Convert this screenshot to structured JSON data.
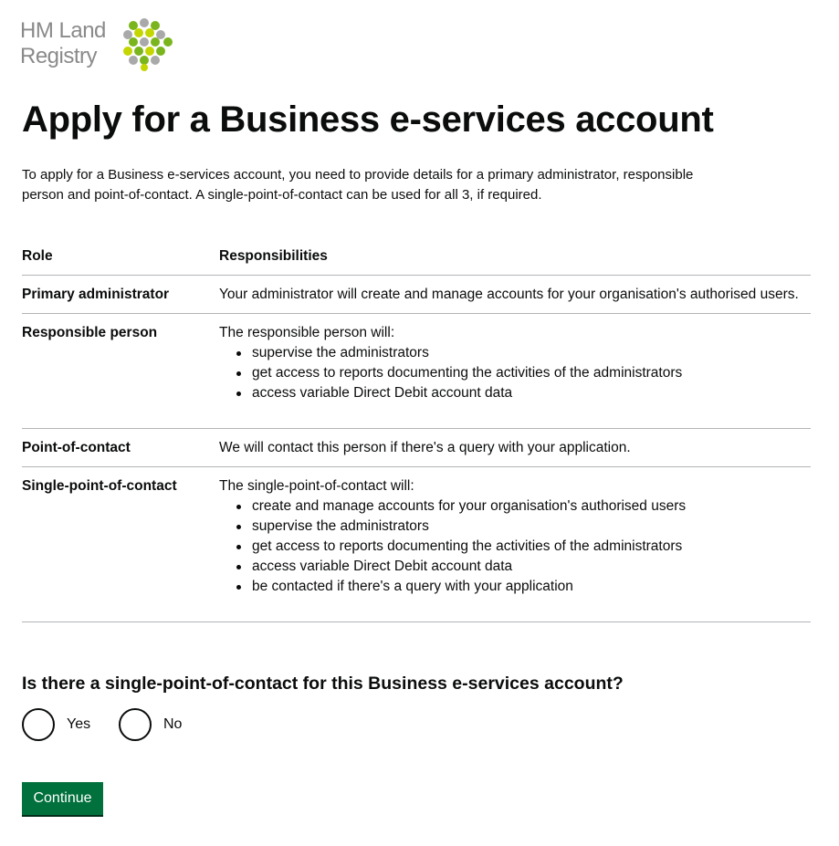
{
  "header": {
    "logo_line1": "HM Land",
    "logo_line2": "Registry"
  },
  "page_title": "Apply for a Business e-services account",
  "intro": "To apply for a Business e-services account, you need to provide details for a primary administrator, responsible person and point-of-contact. A single-point-of-contact can be used for all 3, if required.",
  "table": {
    "headers": [
      "Role",
      "Responsibilities"
    ],
    "rows": [
      {
        "role": "Primary administrator",
        "text": "Your administrator will create and manage accounts for your organisation's authorised users.",
        "bullets": []
      },
      {
        "role": "Responsible person",
        "text": "The responsible person will:",
        "bullets": [
          "supervise the administrators",
          "get access to reports documenting the activities of the administrators",
          "access variable Direct Debit account data"
        ]
      },
      {
        "role": "Point-of-contact",
        "text": "We will contact this person if there's a query with your application.",
        "bullets": []
      },
      {
        "role": "Single-point-of-contact",
        "text": "The single-point-of-contact will:",
        "bullets": [
          "create and manage accounts for your organisation's authorised users",
          "supervise the administrators",
          "get access to reports documenting the activities of the administrators",
          "access variable Direct Debit account data",
          "be contacted if there's a query with your application"
        ]
      }
    ]
  },
  "question": {
    "label": "Is there a single-point-of-contact for this Business e-services account?",
    "options": [
      "Yes",
      "No"
    ]
  },
  "continue_label": "Continue",
  "colors": {
    "button_green": "#00703c",
    "text": "#0b0c0c",
    "border": "#b1b4b6",
    "logo_grey": "#8a8a8a",
    "logo_green": "#7ab51d",
    "logo_lime": "#c4d600"
  }
}
